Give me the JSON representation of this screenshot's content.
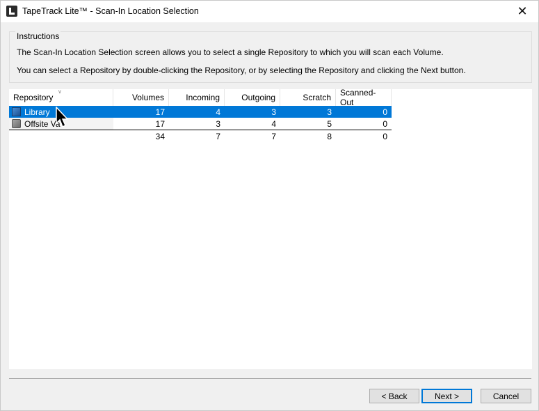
{
  "window": {
    "title": "TapeTrack Lite™ - Scan-In Location Selection",
    "close_glyph": "✕"
  },
  "instructions": {
    "legend": "Instructions",
    "line1": "The Scan-In Location Selection screen allows you to select a single Repository to which you will scan each Volume.",
    "line2": "You can select a Repository by double-clicking the Repository, or by selecting the Repository and clicking the Next button."
  },
  "table": {
    "columns": [
      "Repository",
      "Volumes",
      "Incoming",
      "Outgoing",
      "Scratch",
      "Scanned-Out"
    ],
    "rows": [
      {
        "name": "Library",
        "icon": "library-icon",
        "volumes": "17",
        "incoming": "4",
        "outgoing": "3",
        "scratch": "3",
        "scanned_out": "0",
        "selected": true
      },
      {
        "name": "Offsite Va",
        "icon": "vault-icon",
        "volumes": "17",
        "incoming": "3",
        "outgoing": "4",
        "scratch": "5",
        "scanned_out": "0",
        "selected": false
      }
    ],
    "totals": {
      "volumes": "34",
      "incoming": "7",
      "outgoing": "7",
      "scratch": "8",
      "scanned_out": "0"
    }
  },
  "buttons": {
    "back": "< Back",
    "next": "Next >",
    "cancel": "Cancel"
  },
  "colors": {
    "selection": "#0078d7",
    "default_button_border": "#0078d7"
  }
}
